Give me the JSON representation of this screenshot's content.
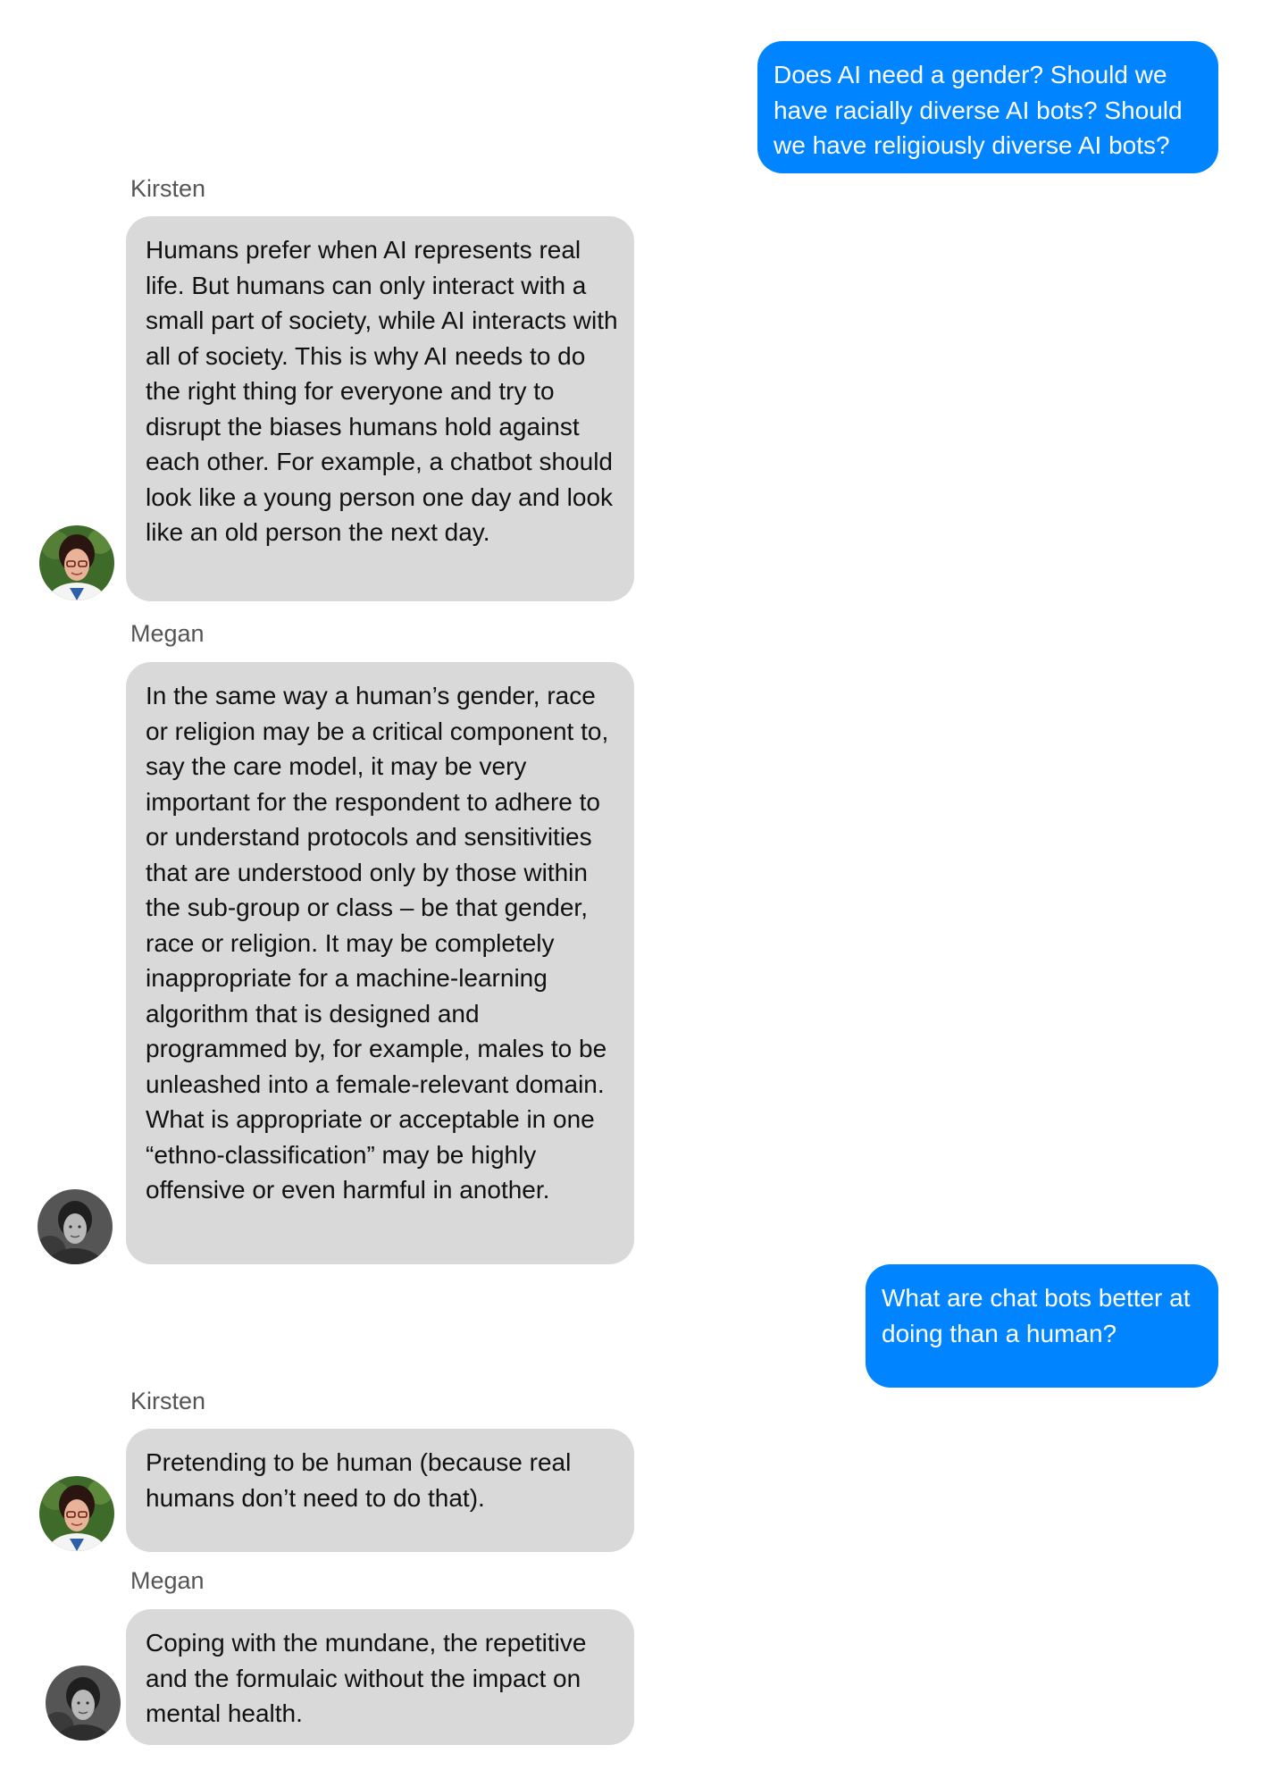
{
  "conversation": {
    "messages": [
      {
        "kind": "outgoing",
        "text": "Does AI need a gender? Should we have racially diverse AI bots? Should we have religiously diverse AI bots?"
      },
      {
        "kind": "incoming",
        "sender": "Kirsten",
        "avatar": "kirsten-avatar",
        "text": "Humans prefer when AI represents real life. But humans can only interact with a small part of society, while AI interacts with all of society. This is why AI needs to do the right thing for everyone and try to disrupt the biases humans hold against each other. For example, a chatbot should look like a young person one day and look like an old person the next day."
      },
      {
        "kind": "incoming",
        "sender": "Megan",
        "avatar": "megan-avatar",
        "text": "In the same way a human’s gender, race or religion may be a critical component to, say the care model, it may be very important for the respondent to adhere to or understand protocols and sensitivities that are understood only by those within the sub-group or class – be that gender, race or religion. It may be completely inappropriate for a machine-learning algorithm that is designed and programmed by, for example, males to be unleashed into a female-relevant domain. What is appropriate or acceptable in one “ethno-classification” may be highly offensive or even harmful in another."
      },
      {
        "kind": "outgoing",
        "text": "What are chat bots better at doing than a human?"
      },
      {
        "kind": "incoming",
        "sender": "Kirsten",
        "avatar": "kirsten-avatar",
        "text": "Pretending to be human (because real humans don’t need to do that)."
      },
      {
        "kind": "incoming",
        "sender": "Megan",
        "avatar": "megan-avatar",
        "text": "Coping with the mundane, the repetitive and the formulaic without the impact on mental health."
      }
    ]
  },
  "colors": {
    "outgoing_bubble": "#0084ff",
    "incoming_bubble": "#d9d9d9",
    "sender_name": "#555555"
  }
}
